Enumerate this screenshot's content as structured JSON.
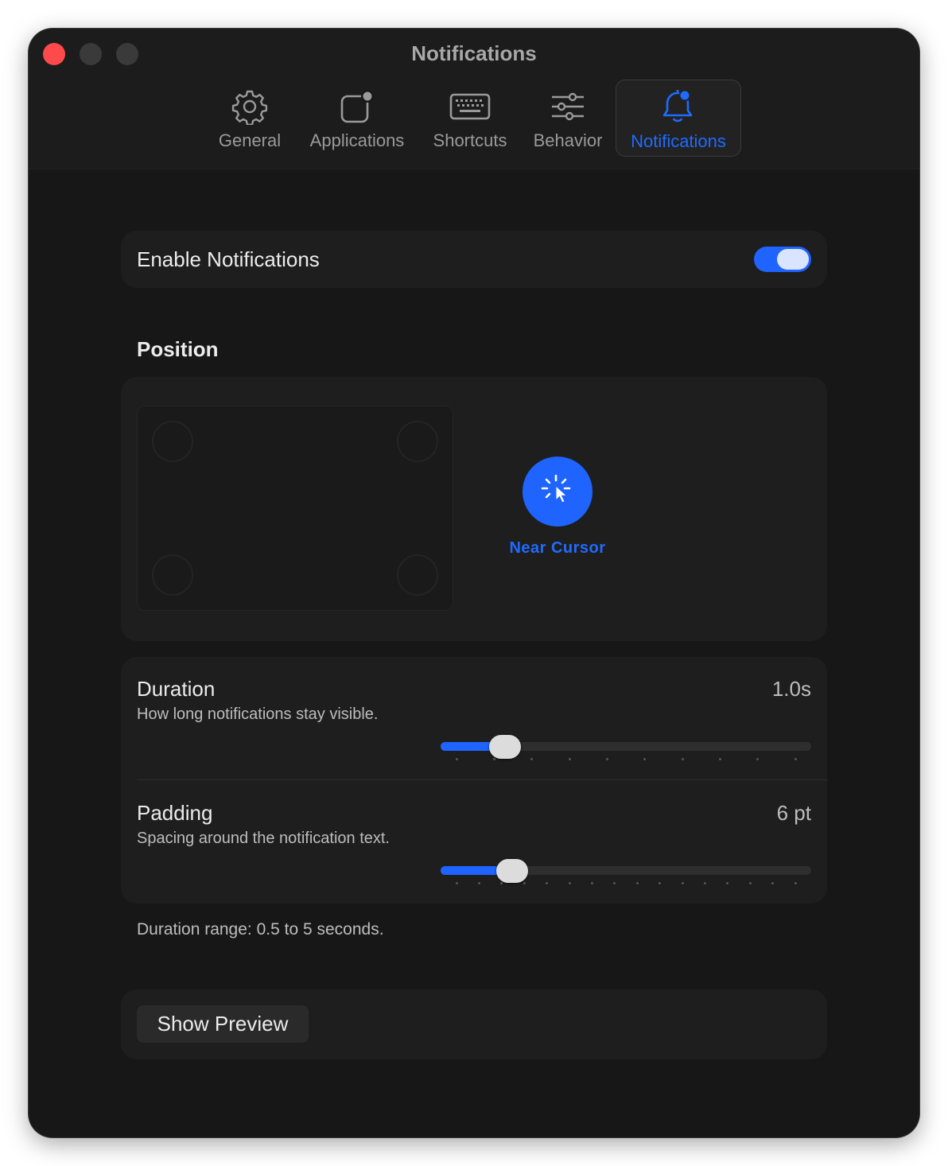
{
  "window": {
    "title": "Notifications"
  },
  "tabs": [
    {
      "label": "General",
      "icon": "gear-icon"
    },
    {
      "label": "Applications",
      "icon": "app-badge-icon"
    },
    {
      "label": "Shortcuts",
      "icon": "keyboard-icon"
    },
    {
      "label": "Behavior",
      "icon": "sliders-icon"
    },
    {
      "label": "Notifications",
      "icon": "bell-badge-icon",
      "active": true
    }
  ],
  "enable": {
    "label": "Enable Notifications",
    "on": true
  },
  "position": {
    "title": "Position",
    "selected": "Near Cursor",
    "near_cursor_label": "Near Cursor",
    "options": [
      "top-left",
      "top-right",
      "bottom-left",
      "bottom-right",
      "near-cursor"
    ]
  },
  "duration": {
    "title": "Duration",
    "value": "1.0s",
    "description": "How long notifications stay visible.",
    "level": 0.143
  },
  "padding": {
    "title": "Padding",
    "value": "6 pt",
    "description": "Spacing around the notification text.",
    "level": 0.165
  },
  "footnote": "Duration range: 0.5 to 5 seconds.",
  "preview": {
    "label": "Show Preview"
  },
  "colors": {
    "accent": "#1f64ff",
    "close": "#fe4a4a",
    "background": "#171717",
    "card": "#1e1e1e"
  }
}
